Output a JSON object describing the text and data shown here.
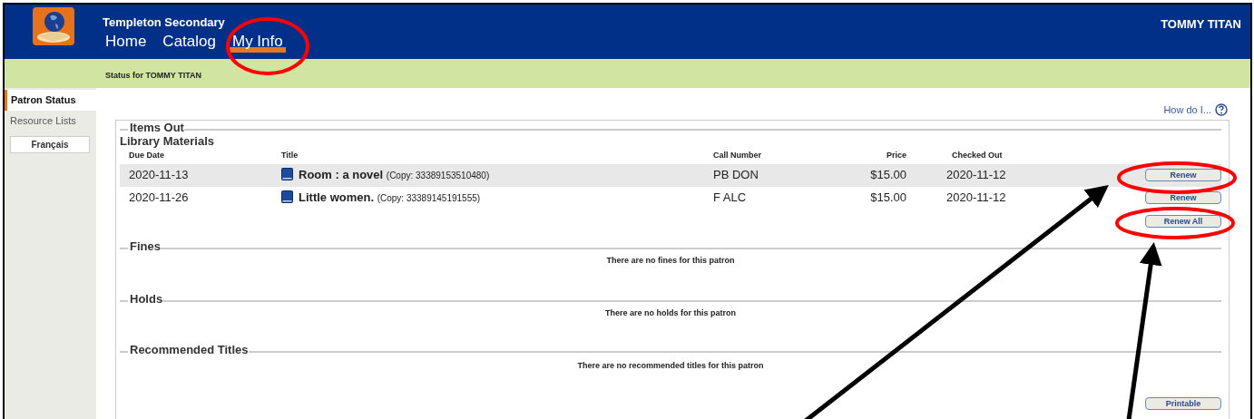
{
  "header": {
    "school": "Templeton Secondary",
    "user": "TOMMY TITAN"
  },
  "nav": [
    {
      "label": "Home",
      "selected": false
    },
    {
      "label": "Catalog",
      "selected": false
    },
    {
      "label": "My Info",
      "selected": true
    }
  ],
  "status_bar": "Status for TOMMY TITAN",
  "sidebar": {
    "items": [
      {
        "label": "Patron Status",
        "selected": true
      },
      {
        "label": "Resource Lists",
        "selected": false
      }
    ],
    "language_button": "Français"
  },
  "help_link": "How do I...",
  "items_out": {
    "heading": "Items Out",
    "subheading": "Library Materials",
    "columns": [
      "Due Date",
      "Title",
      "Call Number",
      "Price",
      "Checked Out"
    ],
    "rows": [
      {
        "due": "2020-11-13",
        "title": "Room : a novel",
        "copy": "(Copy: 33389153510480)",
        "call_number": "PB DON",
        "price": "$15.00",
        "checked_out": "2020-11-12",
        "button": "Renew",
        "selected": true
      },
      {
        "due": "2020-11-26",
        "title": "Little women.",
        "copy": "(Copy: 33389145191555)",
        "call_number": "F ALC",
        "price": "$15.00",
        "checked_out": "2020-11-12",
        "button": "Renew",
        "selected": false
      }
    ],
    "renew_all": "Renew All"
  },
  "sections": [
    {
      "heading": "Fines",
      "message": "There are no fines for this patron"
    },
    {
      "heading": "Holds",
      "message": "There are no holds for this patron"
    },
    {
      "heading": "Recommended Titles",
      "message": "There are no recommended titles for this patron"
    }
  ],
  "printable_button": "Printable"
}
